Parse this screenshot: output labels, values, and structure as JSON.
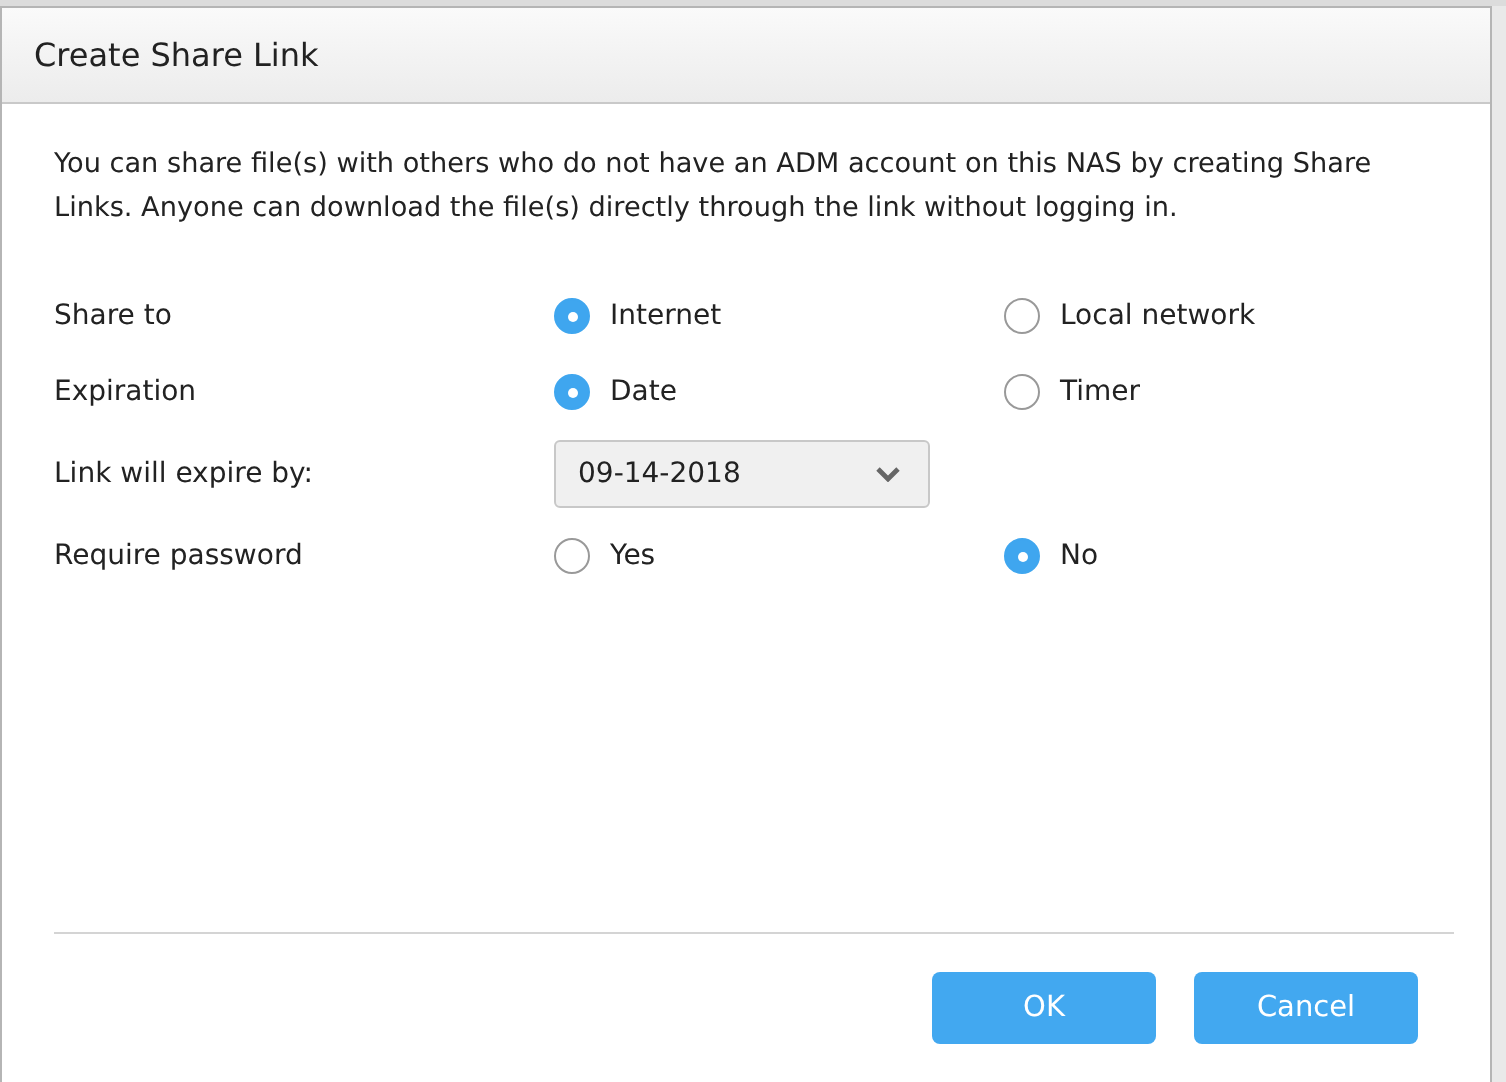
{
  "dialog": {
    "title": "Create Share Link",
    "description": "You can share file(s) with others who do not have an ADM account on this NAS by creating Share Links. Anyone can download the file(s) directly through the link without logging in.",
    "rows": [
      {
        "kind": "radio",
        "label": "Share to",
        "options": [
          {
            "label": "Internet",
            "selected": true
          },
          {
            "label": "Local network",
            "selected": false
          }
        ]
      },
      {
        "kind": "radio",
        "label": "Expiration",
        "options": [
          {
            "label": "Date",
            "selected": true
          },
          {
            "label": "Timer",
            "selected": false
          }
        ]
      },
      {
        "kind": "select",
        "label": "Link will expire by:",
        "value": "09-14-2018"
      },
      {
        "kind": "radio",
        "label": "Require password",
        "options": [
          {
            "label": "Yes",
            "selected": false
          },
          {
            "label": "No",
            "selected": true
          }
        ]
      }
    ],
    "buttons": [
      "OK",
      "Cancel"
    ]
  }
}
